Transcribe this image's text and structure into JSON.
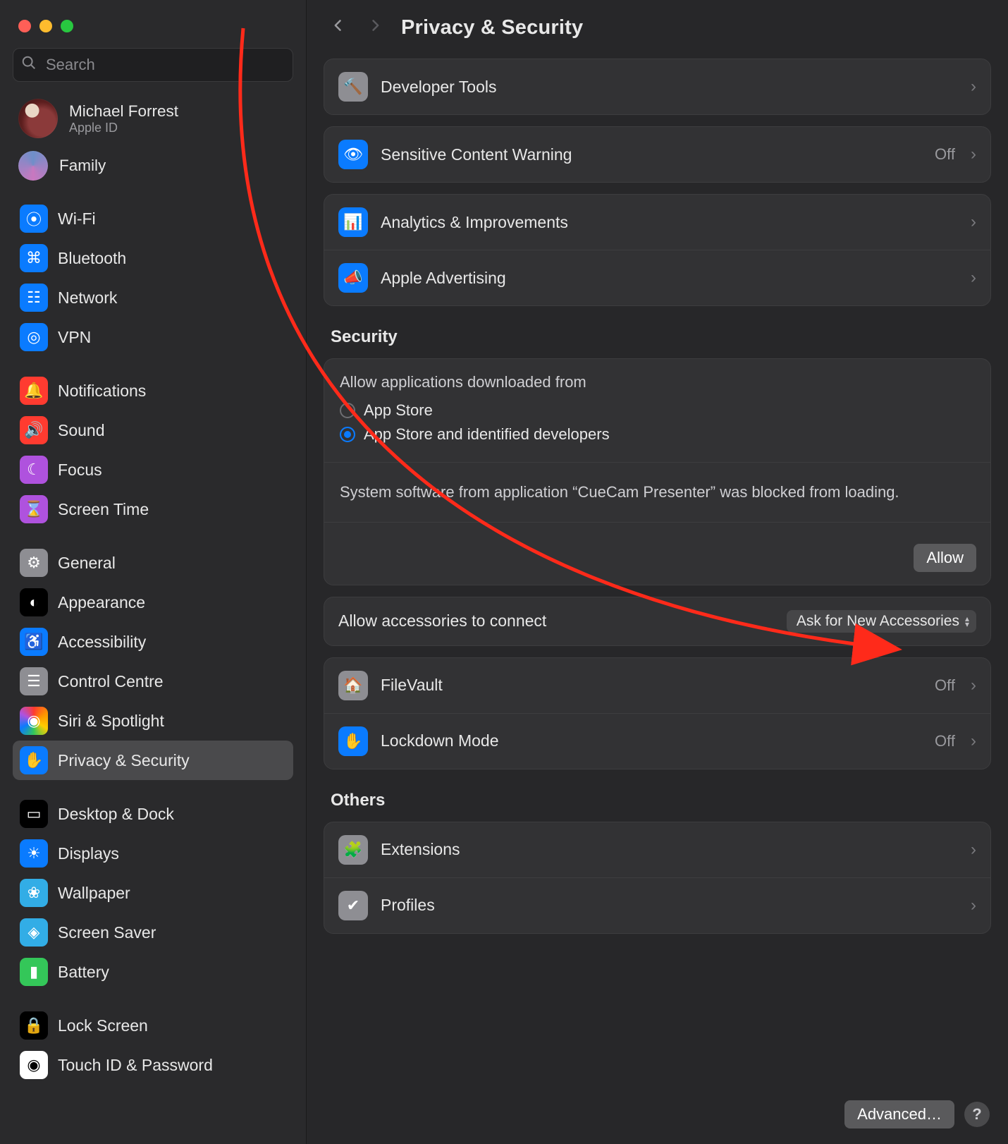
{
  "window": {
    "title": "Privacy & Security"
  },
  "search": {
    "placeholder": "Search"
  },
  "account": {
    "name": "Michael Forrest",
    "subtitle": "Apple ID"
  },
  "family": {
    "label": "Family"
  },
  "sidebar_groups": [
    {
      "items": [
        {
          "icon": "wifi-icon",
          "label": "Wi-Fi",
          "bg": "bg-blue",
          "glyph": "⦿"
        },
        {
          "icon": "bluetooth-icon",
          "label": "Bluetooth",
          "bg": "bg-blue",
          "glyph": "⌘"
        },
        {
          "icon": "network-icon",
          "label": "Network",
          "bg": "bg-blue",
          "glyph": "☷"
        },
        {
          "icon": "vpn-icon",
          "label": "VPN",
          "bg": "bg-blue",
          "glyph": "◎"
        }
      ]
    },
    {
      "items": [
        {
          "icon": "notifications-icon",
          "label": "Notifications",
          "bg": "bg-red",
          "glyph": "🔔"
        },
        {
          "icon": "sound-icon",
          "label": "Sound",
          "bg": "bg-red",
          "glyph": "🔊"
        },
        {
          "icon": "focus-icon",
          "label": "Focus",
          "bg": "bg-purple",
          "glyph": "☾"
        },
        {
          "icon": "screen-time-icon",
          "label": "Screen Time",
          "bg": "bg-purple",
          "glyph": "⌛"
        }
      ]
    },
    {
      "items": [
        {
          "icon": "general-icon",
          "label": "General",
          "bg": "bg-gray",
          "glyph": "⚙"
        },
        {
          "icon": "appearance-icon",
          "label": "Appearance",
          "bg": "bg-black",
          "glyph": "◐"
        },
        {
          "icon": "accessibility-icon",
          "label": "Accessibility",
          "bg": "bg-blue",
          "glyph": "♿"
        },
        {
          "icon": "control-centre-icon",
          "label": "Control Centre",
          "bg": "bg-gray",
          "glyph": "☰"
        },
        {
          "icon": "siri-icon",
          "label": "Siri & Spotlight",
          "bg": "bg-rainbow",
          "glyph": "◉"
        },
        {
          "icon": "privacy-icon",
          "label": "Privacy & Security",
          "bg": "bg-blue",
          "glyph": "✋",
          "selected": true
        }
      ]
    },
    {
      "items": [
        {
          "icon": "desktop-dock-icon",
          "label": "Desktop & Dock",
          "bg": "bg-black",
          "glyph": "▭"
        },
        {
          "icon": "displays-icon",
          "label": "Displays",
          "bg": "bg-blue",
          "glyph": "☀"
        },
        {
          "icon": "wallpaper-icon",
          "label": "Wallpaper",
          "bg": "bg-cyan",
          "glyph": "❀"
        },
        {
          "icon": "screen-saver-icon",
          "label": "Screen Saver",
          "bg": "bg-cyan",
          "glyph": "◈"
        },
        {
          "icon": "battery-icon",
          "label": "Battery",
          "bg": "bg-green",
          "glyph": "▮"
        }
      ]
    },
    {
      "items": [
        {
          "icon": "lock-screen-icon",
          "label": "Lock Screen",
          "bg": "bg-black",
          "glyph": "🔒"
        },
        {
          "icon": "touchid-icon",
          "label": "Touch ID & Password",
          "bg": "bg-white",
          "glyph": "◉"
        }
      ]
    }
  ],
  "main": {
    "rows_top": [
      {
        "icon": "hammer-icon",
        "label": "Developer Tools",
        "bg": "bg-gray",
        "glyph": "🔨"
      }
    ],
    "rows_group2": [
      {
        "icon": "eye-icon",
        "label": "Sensitive Content Warning",
        "bg": "bg-blue",
        "glyph": "👁",
        "value": "Off"
      }
    ],
    "rows_group3": [
      {
        "icon": "chart-icon",
        "label": "Analytics & Improvements",
        "bg": "bg-blue",
        "glyph": "📊"
      },
      {
        "icon": "megaphone-icon",
        "label": "Apple Advertising",
        "bg": "bg-blue",
        "glyph": "📣"
      }
    ],
    "security_header": "Security",
    "allow_from_label": "Allow applications downloaded from",
    "allow_from_options": [
      {
        "label": "App Store",
        "checked": false
      },
      {
        "label": "App Store and identified developers",
        "checked": true
      }
    ],
    "blocked_message": "System software from application “CueCam Presenter” was blocked from loading.",
    "allow_button": "Allow",
    "accessories_label": "Allow accessories to connect",
    "accessories_value": "Ask for New Accessories",
    "rows_group4": [
      {
        "icon": "filevault-icon",
        "label": "FileVault",
        "bg": "bg-gray",
        "glyph": "🏠",
        "value": "Off"
      },
      {
        "icon": "lockdown-icon",
        "label": "Lockdown Mode",
        "bg": "bg-blue",
        "glyph": "✋",
        "value": "Off"
      }
    ],
    "others_header": "Others",
    "rows_group5": [
      {
        "icon": "extensions-icon",
        "label": "Extensions",
        "bg": "bg-gray",
        "glyph": "🧩"
      },
      {
        "icon": "profiles-icon",
        "label": "Profiles",
        "bg": "bg-gray",
        "glyph": "✔"
      }
    ],
    "advanced_button": "Advanced…"
  }
}
